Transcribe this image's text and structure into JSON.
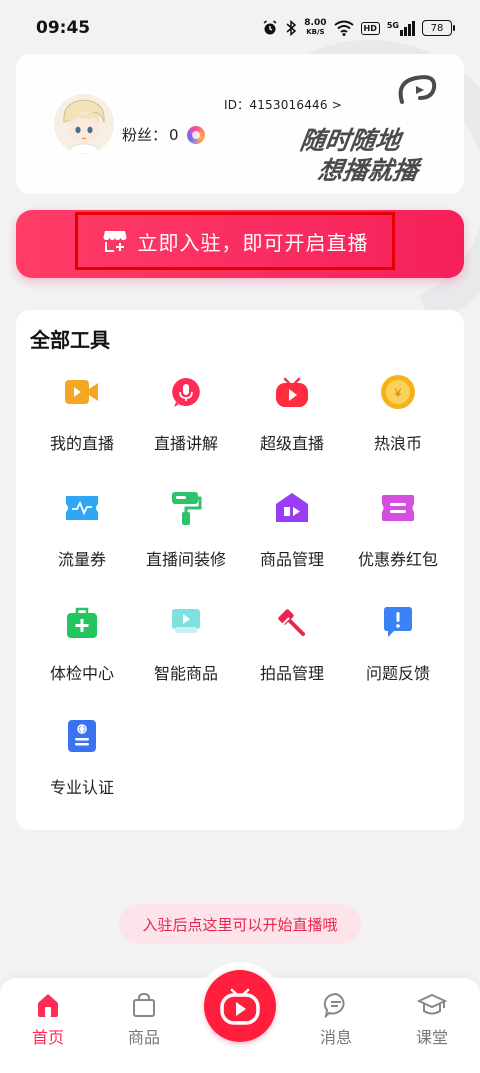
{
  "status_bar": {
    "time": "09:45",
    "net_speed_value": "8.00",
    "net_speed_unit": "KB/S",
    "hd_label": "HD",
    "signal_label": "5G",
    "battery": "78"
  },
  "profile": {
    "user_id": "ID：4153016446 >",
    "fans_label": "粉丝：",
    "fans_count": "0",
    "slogan_line1": "随时随地",
    "slogan_line2": "想播就播"
  },
  "banner": {
    "label": "立即入驻，即可开启直播"
  },
  "tools": {
    "title": "全部工具",
    "items": [
      {
        "label": "我的直播",
        "icon": "video-camera-icon",
        "color": "#f5a623"
      },
      {
        "label": "直播讲解",
        "icon": "microphone-icon",
        "color": "#ff2d55"
      },
      {
        "label": "超级直播",
        "icon": "play-tv-icon",
        "color": "#ff2d3f"
      },
      {
        "label": "热浪币",
        "icon": "coin-icon",
        "color": "#f7b21b"
      },
      {
        "label": "流量券",
        "icon": "traffic-ticket-icon",
        "color": "#2ea8f5"
      },
      {
        "label": "直播间装修",
        "icon": "paint-roller-icon",
        "color": "#2cc36b"
      },
      {
        "label": "商品管理",
        "icon": "store-video-icon",
        "color": "#9b3cf5"
      },
      {
        "label": "优惠券红包",
        "icon": "coupon-icon",
        "color": "#d64ee0"
      },
      {
        "label": "体检中心",
        "icon": "first-aid-kit-icon",
        "color": "#22c55e"
      },
      {
        "label": "智能商品",
        "icon": "smart-product-icon",
        "color": "#5fd3d3"
      },
      {
        "label": "拍品管理",
        "icon": "auction-hammer-icon",
        "color": "#e8264f"
      },
      {
        "label": "问题反馈",
        "icon": "feedback-icon",
        "color": "#3b82f6"
      },
      {
        "label": "专业认证",
        "icon": "certificate-icon",
        "color": "#3b72f0"
      }
    ]
  },
  "tooltip": {
    "text": "入驻后点这里可以开始直播哦"
  },
  "bottom_nav": {
    "items": [
      {
        "label": "首页",
        "icon": "home-icon",
        "active": true
      },
      {
        "label": "商品",
        "icon": "shopping-bag-icon",
        "active": false
      },
      {
        "label": "消息",
        "icon": "message-icon",
        "active": false
      },
      {
        "label": "课堂",
        "icon": "graduation-cap-icon",
        "active": false
      }
    ],
    "center_button": "live-play-icon"
  },
  "colors": {
    "accent": "#ff2d55",
    "banner_start": "#ff3d67",
    "banner_end": "#f5205a",
    "live_button": "#ff1f3d"
  }
}
